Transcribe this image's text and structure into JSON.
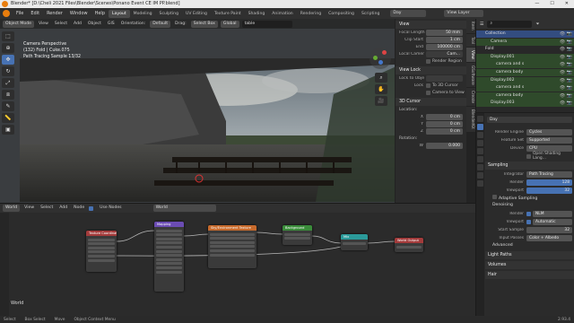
{
  "titlebar": {
    "title": "Blender* [D:\\Cheli 2021 Files\\Blender\\Scenes\\Ponano Event CE IM PP.blend]",
    "min": "—",
    "max": "☐",
    "close": "✕"
  },
  "topmenu": {
    "menus": [
      "File",
      "Edit",
      "Render",
      "Window",
      "Help"
    ],
    "workspaces": [
      "Layout",
      "Modeling",
      "Sculpting",
      "UV Editing",
      "Texture Paint",
      "Shading",
      "Animation",
      "Rendering",
      "Compositing",
      "Scripting"
    ],
    "active_workspace": "Layout",
    "scene": "Day",
    "view_layer": "View Layer"
  },
  "viewport": {
    "header": {
      "mode": "Object Mode",
      "view": "View",
      "select": "Select",
      "add": "Add",
      "object": "Object",
      "gis": "GIS",
      "orientation_label": "Orientation:",
      "orientation": "Default",
      "drag_label": "Drag:",
      "drag": "Select Box",
      "pivot": "Global",
      "search": "table"
    },
    "info": [
      "Camera Perspective",
      "(132) Fold | Cuke.075",
      "Path Tracing Sample 13/32"
    ]
  },
  "npanel": {
    "view_title": "View",
    "focal_length_label": "Focal Length",
    "focal_length": "50 mm",
    "clip_start_label": "Clip Start",
    "clip_start": "1 cm",
    "end_label": "End",
    "end": "100000 cm",
    "local_camera_label": "Local Camer",
    "local_camera": "Cam...",
    "render_region": "Render Region",
    "view_lock_title": "View Lock",
    "lock_to_obj_label": "Lock to Obje",
    "lock_label": "Lock",
    "to_3d_cursor": "To 3D Cursor",
    "camera_to_view": "Camera to View",
    "cursor_title": "3D Cursor",
    "location_label": "Location:",
    "x": "0 cm",
    "y": "0 cm",
    "z": "0 cm",
    "rotation_label": "Rotation:",
    "w": "0.000"
  },
  "vtabs": [
    "Item",
    "Tool",
    "View",
    "GSoftware",
    "Create",
    "BlenderKit"
  ],
  "node_editor": {
    "header": {
      "type": "World",
      "view": "View",
      "select": "Select",
      "add": "Add",
      "node": "Node",
      "use_nodes": "Use Nodes",
      "slot": "World"
    },
    "label": "World",
    "nodes": [
      {
        "title": "Texture Coordinate",
        "color": "#a33b3b"
      },
      {
        "title": "Mapping",
        "color": "#6b4cb3"
      },
      {
        "title": "Sky/Environment Texture",
        "color": "#c76a2c"
      },
      {
        "title": "Background",
        "color": "#3a8c3a"
      },
      {
        "title": "Mix",
        "color": "#2b9a9a"
      },
      {
        "title": "World Output",
        "color": "#a33b3b"
      }
    ]
  },
  "outliner": {
    "rows": [
      {
        "label": "Collection",
        "indent": 1,
        "style": "sel"
      },
      {
        "label": "Camera",
        "indent": 2,
        "style": "green"
      },
      {
        "label": "Fold",
        "indent": 1,
        "style": ""
      },
      {
        "label": "Display.001",
        "indent": 2,
        "style": "green"
      },
      {
        "label": "camera and s",
        "indent": 3,
        "style": "green"
      },
      {
        "label": "camera body",
        "indent": 3,
        "style": "green"
      },
      {
        "label": "Display.002",
        "indent": 2,
        "style": "green"
      },
      {
        "label": "camera and s",
        "indent": 3,
        "style": "green"
      },
      {
        "label": "camera body",
        "indent": 3,
        "style": "green"
      },
      {
        "label": "Display.003",
        "indent": 2,
        "style": "green"
      }
    ]
  },
  "properties": {
    "scene": "Day",
    "render_engine_label": "Render Engine",
    "render_engine": "Cycles",
    "feature_set_label": "Feature Set",
    "feature_set": "Supported",
    "device_label": "Device",
    "device": "CPU",
    "open_shading": "Open Shading Lang...",
    "sampling": "Sampling",
    "integrator_label": "Integrator",
    "integrator": "Path Tracing",
    "render_label": "Render",
    "render_samples": "128",
    "viewport_label": "Viewport",
    "viewport_samples": "32",
    "adaptive": "Adaptive Sampling",
    "denoising": "Denoising",
    "den_render_label": "Render",
    "den_render": "NLM",
    "den_viewport_label": "Viewport",
    "den_viewport": "Automatic",
    "start_sample_label": "Start Sample",
    "start_sample": "32",
    "input_passes_label": "Input Passes",
    "input_passes": "Color + Albedo",
    "advanced": "Advanced",
    "light_paths": "Light Paths",
    "volumes": "Volumes",
    "hair": "Hair"
  },
  "statusbar": {
    "select": "Select",
    "box_select": "Box Select",
    "move": "Move",
    "context": "Object Context Menu",
    "version": "2.93.4"
  }
}
